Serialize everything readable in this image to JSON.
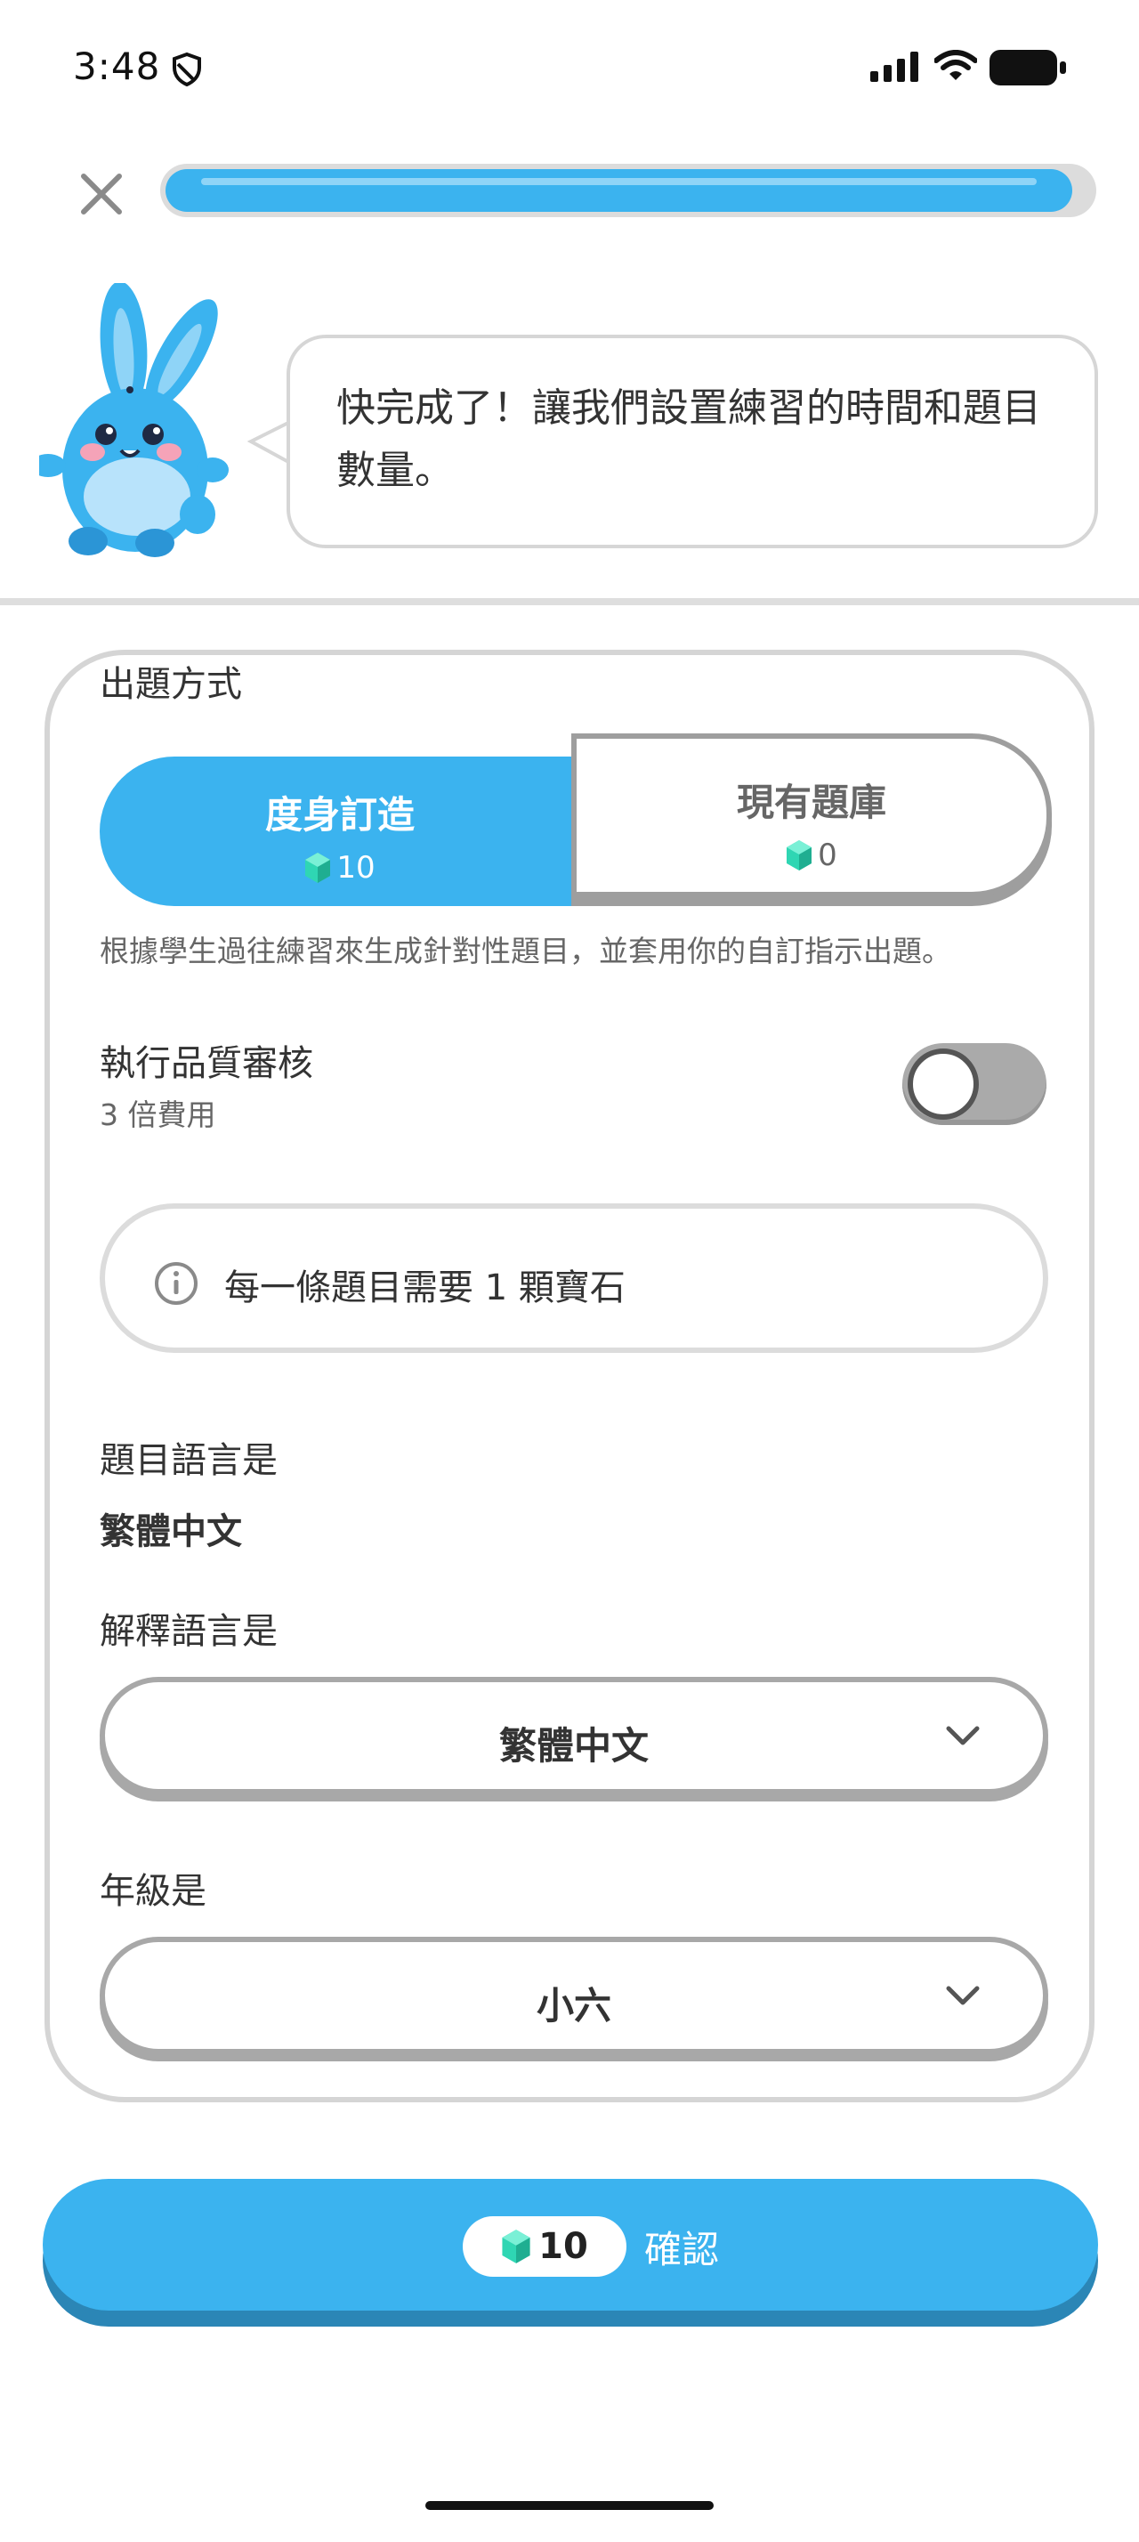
{
  "status_bar": {
    "time": "3:48"
  },
  "progress": {
    "fraction": 0.98
  },
  "mascot_message": "快完成了！讓我們設置練習的時間和題目數量。",
  "card": {
    "question_method_label": "出題方式",
    "segments": [
      {
        "label": "度身訂造",
        "gems": "10",
        "selected": true
      },
      {
        "label": "現有題庫",
        "gems": "0",
        "selected": false
      }
    ],
    "description": "根據學生過往練習來生成針對性題目，並套用你的自訂指示出題。",
    "quality_review": {
      "label": "執行品質審核",
      "sublabel": "3 倍費用",
      "enabled": false
    },
    "info": "每一條題目需要 1 顆寶石",
    "question_language": {
      "label": "題目語言是",
      "value": "繁體中文"
    },
    "explanation_language": {
      "label": "解釋語言是",
      "value": "繁體中文"
    },
    "grade": {
      "label": "年級是",
      "value": "小六"
    }
  },
  "confirm": {
    "gems": "10",
    "label": "確認"
  },
  "colors": {
    "accent": "#3bb3ef",
    "gem": "#2fd6b3",
    "toggle_off": "#aaaaaa"
  },
  "icons": [
    "close-icon",
    "shield-icon",
    "signal-icon",
    "wifi-icon",
    "battery-icon",
    "gem-icon",
    "info-icon",
    "chevron-down-icon"
  ]
}
